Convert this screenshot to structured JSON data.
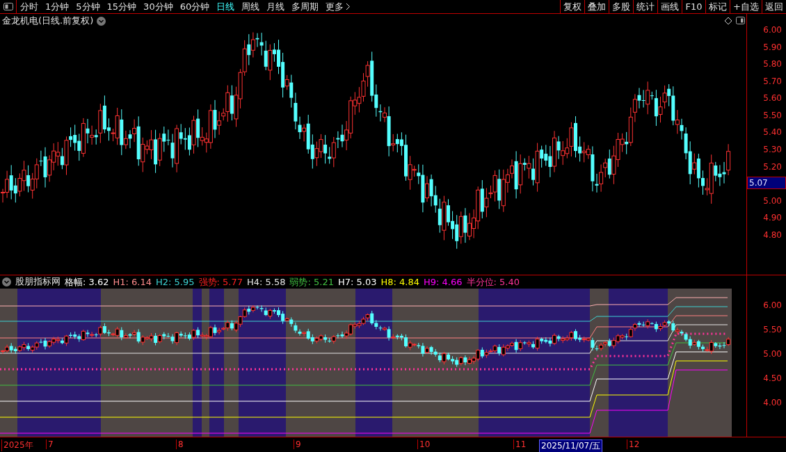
{
  "toolbar": {
    "periods": [
      {
        "label": "分时",
        "selected": false
      },
      {
        "label": "1分钟",
        "selected": false
      },
      {
        "label": "5分钟",
        "selected": false
      },
      {
        "label": "15分钟",
        "selected": false
      },
      {
        "label": "30分钟",
        "selected": false
      },
      {
        "label": "60分钟",
        "selected": false
      },
      {
        "label": "日线",
        "selected": true
      },
      {
        "label": "周线",
        "selected": false
      },
      {
        "label": "月线",
        "selected": false
      },
      {
        "label": "多周期",
        "selected": false
      }
    ],
    "more": "更多",
    "buttons": [
      "复权",
      "叠加",
      "多股",
      "统计",
      "画线",
      "F10",
      "标记",
      "+自选",
      "返回"
    ]
  },
  "main_chart": {
    "title": "金龙机电(日线.前复权)",
    "y_ticks": [
      "6.00",
      "5.90",
      "5.80",
      "5.70",
      "5.60",
      "5.50",
      "5.40",
      "5.30",
      "5.20",
      "5.00",
      "4.90",
      "4.80"
    ],
    "current_price": "5.07"
  },
  "indicator": {
    "name": "股朋指标网",
    "items": [
      {
        "text": "格幅: 3.62",
        "color": "#ffffff"
      },
      {
        "text": "H1: 6.14",
        "color": "#ff8c8c"
      },
      {
        "text": "H2: 5.95",
        "color": "#3cd2d2"
      },
      {
        "text": "强势: 5.77",
        "color": "#ff2020"
      },
      {
        "text": "H4: 5.58",
        "color": "#e6e6e6"
      },
      {
        "text": "弱势: 5.21",
        "color": "#40c040"
      },
      {
        "text": "H7: 5.03",
        "color": "#ffffff"
      },
      {
        "text": "H8: 4.84",
        "color": "#ffff00"
      },
      {
        "text": "H9: 4.66",
        "color": "#ff00ff"
      },
      {
        "text": "半分位: 5.40",
        "color": "#ff3399"
      }
    ],
    "y_ticks": [
      "6.00",
      "5.50",
      "5.00",
      "4.50",
      "4.00"
    ]
  },
  "x_axis": {
    "labels": [
      {
        "text": "2025年",
        "selected": false
      },
      {
        "text": "7",
        "selected": false
      },
      {
        "text": "8",
        "selected": false
      },
      {
        "text": "9",
        "selected": false
      },
      {
        "text": "10",
        "selected": false
      },
      {
        "text": "11",
        "selected": false
      },
      {
        "text": "2025/11/07/五",
        "selected": true
      },
      {
        "text": "12",
        "selected": false
      }
    ]
  }
}
